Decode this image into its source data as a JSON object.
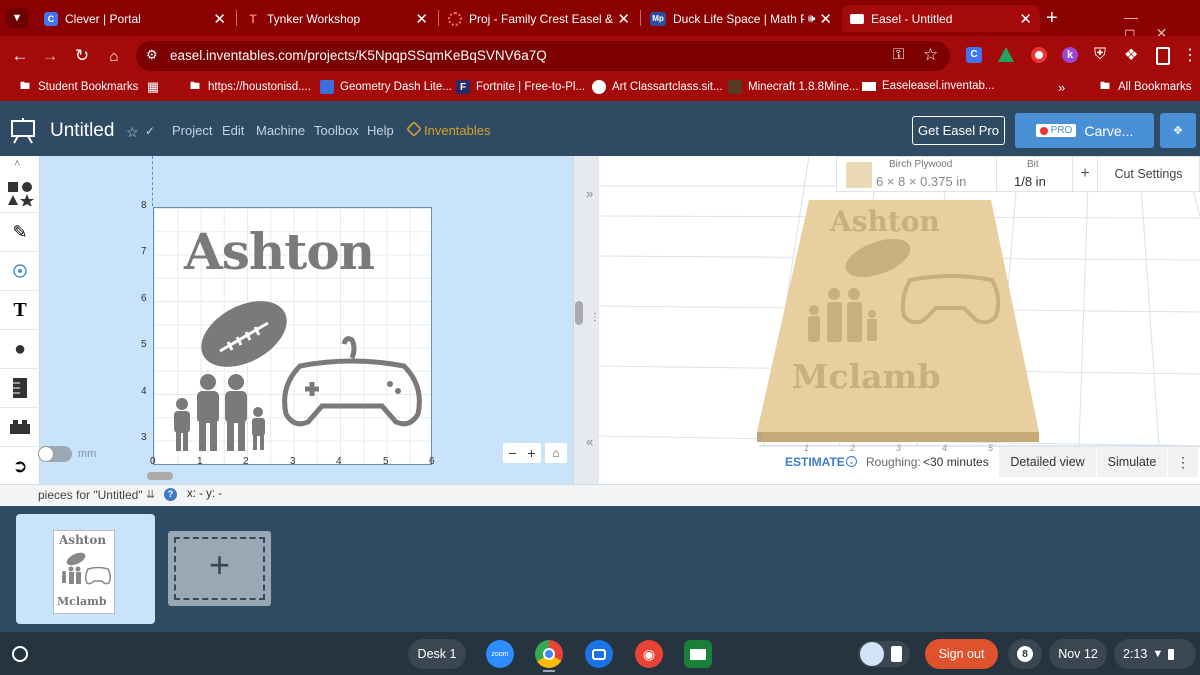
{
  "browser": {
    "tabs": [
      {
        "title": "Clever | Portal",
        "icon_label": "C",
        "icon_color": "#4274f6"
      },
      {
        "title": "Tynker Workshop",
        "icon_label": "T",
        "icon_color": "#e24949"
      },
      {
        "title": "Proj - Family Crest Easel & X-C",
        "icon_label": "",
        "icon_color": "#e24949"
      },
      {
        "title": "Duck Life Space | Math Pl",
        "icon_label": "Mp",
        "icon_color": "#2e4f9e"
      },
      {
        "title": "Easel - Untitled",
        "icon_label": "",
        "icon_color": "#ffffff"
      }
    ],
    "url": "easel.inventables.com/projects/K5NpqpSSqmKeBqSVNV6a7Q",
    "bookmarks": [
      {
        "label": "Student Bookmarks"
      },
      {
        "label": ""
      },
      {
        "label": "https://houstonisd...."
      },
      {
        "label": "Geometry Dash Lite..."
      },
      {
        "label": "Fortnite | Free-to-Pl..."
      },
      {
        "label": "Art Classartclass.sit..."
      },
      {
        "label": "Minecraft 1.8.8Mine..."
      },
      {
        "label": "Easeleasel.inventab..."
      }
    ],
    "all_bookmarks": "All Bookmarks",
    "more": "»",
    "new_tab": "+"
  },
  "app": {
    "project_title": "Untitled",
    "menu": [
      "Project",
      "Edit",
      "Machine",
      "Toolbox",
      "Help"
    ],
    "brand": "Inventables",
    "get_pro": "Get Easel Pro",
    "pro_badge": "PRO",
    "carve": "Carve..."
  },
  "canvas": {
    "y_ticks": [
      "8",
      "7",
      "6",
      "5",
      "4",
      "3"
    ],
    "x_ticks": [
      "0",
      "1",
      "2",
      "3",
      "4",
      "5",
      "6"
    ],
    "unit_label": "mm",
    "design_top_text": "Ashton",
    "minus": "−",
    "plus": "+",
    "collapse_arrow": "»",
    "expand_arrow": "«"
  },
  "material": {
    "name": "Birch Plywood",
    "dims": "6 × 8 × 0.375 in",
    "bit_label": "Bit",
    "bit_value": "1/8 in",
    "add": "+",
    "cut_settings": "Cut Settings",
    "swatch_color": "#ecd9b5"
  },
  "preview": {
    "top_text": "Ashton",
    "bottom_text": "Mclamb",
    "axis": [
      "0",
      "1",
      "2",
      "3",
      "4",
      "5"
    ],
    "estimate": "ESTIMATE",
    "roughing_label": "Roughing:",
    "roughing_value": "<30 minutes",
    "detailed_view": "Detailed view",
    "simulate": "Simulate"
  },
  "dock": {
    "pieces_label": "pieces for \"Untitled\"",
    "help": "?",
    "coords": "x: - y: -"
  },
  "tray": {
    "thumb_top": "Ashton",
    "thumb_bottom": "Mclamb",
    "add": "+"
  },
  "taskbar": {
    "desk": "Desk 1",
    "zoom": "zoom",
    "sign_out": "Sign out",
    "notif_count": "8",
    "date": "Nov 12",
    "time": "2:13"
  }
}
